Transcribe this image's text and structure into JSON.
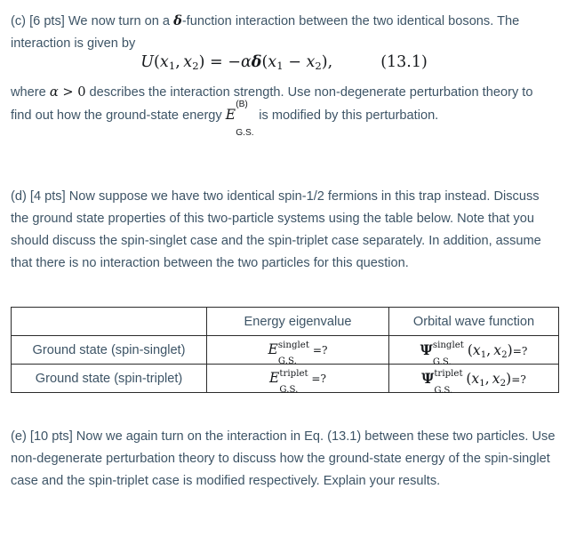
{
  "document": {
    "type": "physics-problem-set",
    "background_color": "#ffffff",
    "body_text_color": "#3d5466",
    "math_text_color": "#16191c"
  },
  "part_c": {
    "label": "(c)",
    "points": "[6 pts]",
    "text_before_delta": "We now turn on a ",
    "delta_symbol": "δ",
    "text_after_delta": "-function interaction between the two identical bosons. The interaction is given by",
    "full_text": "(c) [6 pts] We now turn on a δ-function interaction between the two identical bosons. The interaction is given by"
  },
  "equation": {
    "number": "(13.1)",
    "latex": "U(x_1,x_2) = -\\alpha\\delta(x_1 - x_2),",
    "lhs_symbol": "U",
    "arg1": "x",
    "arg1_sub": "1",
    "arg2": "x",
    "arg2_sub": "2",
    "equals": "=",
    "minus": "−",
    "alpha": "α",
    "delta": "δ",
    "comma": ","
  },
  "part_c_tail": {
    "text_1": "where ",
    "alpha": "α",
    "gt": ">",
    "zero": "0",
    "text_2": " describes the interaction strength. Use non-degenerate perturbation theory to find out how the ground-state energy ",
    "energy_symbol": "E",
    "energy_sup": "(B)",
    "energy_sub": "G.S.",
    "text_3": " is modified by this perturbation.",
    "full_text": "where α > 0 describes the interaction strength. Use non-degenerate perturbation theory to find out how the ground-state energy E^(B)_G.S. is modified by this perturbation."
  },
  "part_d": {
    "label": "(d)",
    "points": "[4 pts]",
    "full_text": "(d) [4 pts] Now suppose we have two identical spin-1/2 fermions in this trap instead. Discuss the ground state properties of this two-particle systems using the table below. Note that you should discuss the spin-singlet case and the spin-triplet case separately. In addition, assume that there is no interaction between the two particles for this question."
  },
  "table": {
    "border_color": "#2b2b2b",
    "headers": [
      "",
      "Energy eigenvalue",
      "Orbital wave function"
    ],
    "rows": [
      {
        "label": "Ground state (spin-singlet)",
        "energy": {
          "symbol": "E",
          "superscript": "singlet",
          "subscript": "G.S.",
          "value": "=?"
        },
        "orbital": {
          "symbol": "Ψ",
          "superscript": "singlet",
          "subscript": "G.S.",
          "args": "(x₁, x₂)",
          "arg1": "x",
          "arg1_sub": "1",
          "arg2": "x",
          "arg2_sub": "2",
          "value": "=?"
        }
      },
      {
        "label": "Ground state (spin-triplet)",
        "energy": {
          "symbol": "E",
          "superscript": "triplet",
          "subscript": "G.S.",
          "value": "=?"
        },
        "orbital": {
          "symbol": "Ψ",
          "superscript": "triplet",
          "subscript": "G.S.",
          "args": "(x₁, x₂)",
          "arg1": "x",
          "arg1_sub": "1",
          "arg2": "x",
          "arg2_sub": "2",
          "value": "=?"
        }
      }
    ]
  },
  "part_e": {
    "label": "(e)",
    "points": "[10 pts]",
    "full_text": "(e) [10 pts] Now we again turn on the interaction in Eq. (13.1) between these two particles. Use non-degenerate perturbation theory to discuss how the ground-state energy of the spin-singlet case and the spin-triplet case is modified respectively. Explain your results."
  }
}
